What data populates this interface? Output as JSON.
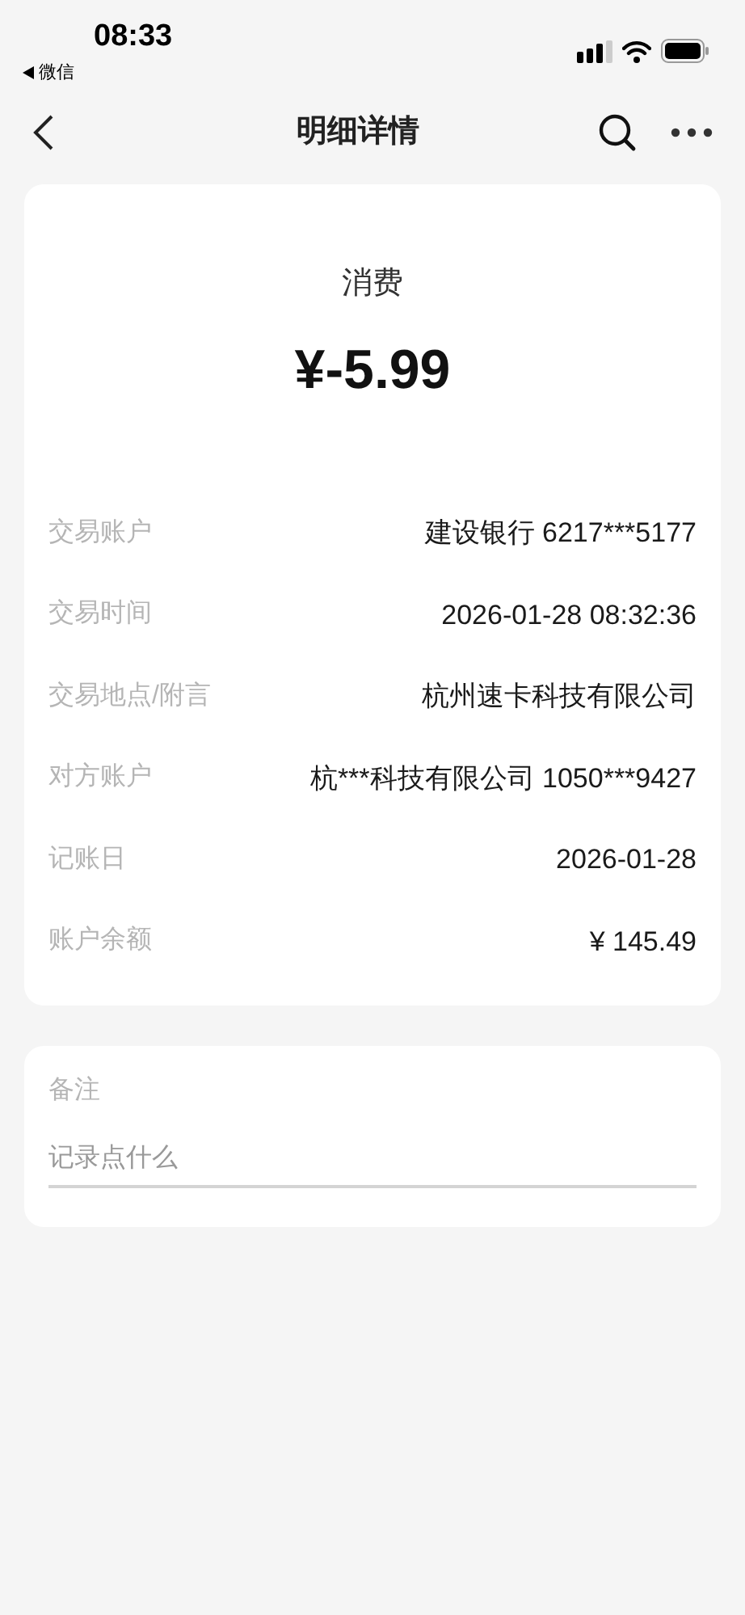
{
  "status_bar": {
    "time": "08:33",
    "back_app": "微信"
  },
  "nav": {
    "title": "明细详情"
  },
  "summary": {
    "type": "消费",
    "amount": "¥-5.99"
  },
  "details": [
    {
      "label": "交易账户",
      "value": "建设银行 6217***5177"
    },
    {
      "label": "交易时间",
      "value": "2026-01-28 08:32:36"
    },
    {
      "label": "交易地点/附言",
      "value": "杭州速卡科技有限公司"
    },
    {
      "label": "对方账户",
      "value": "杭***科技有限公司 1050***9427"
    },
    {
      "label": "记账日",
      "value": "2026-01-28"
    },
    {
      "label": "账户余额",
      "value": "¥ 145.49"
    }
  ],
  "note": {
    "label": "备注",
    "placeholder": "记录点什么"
  }
}
